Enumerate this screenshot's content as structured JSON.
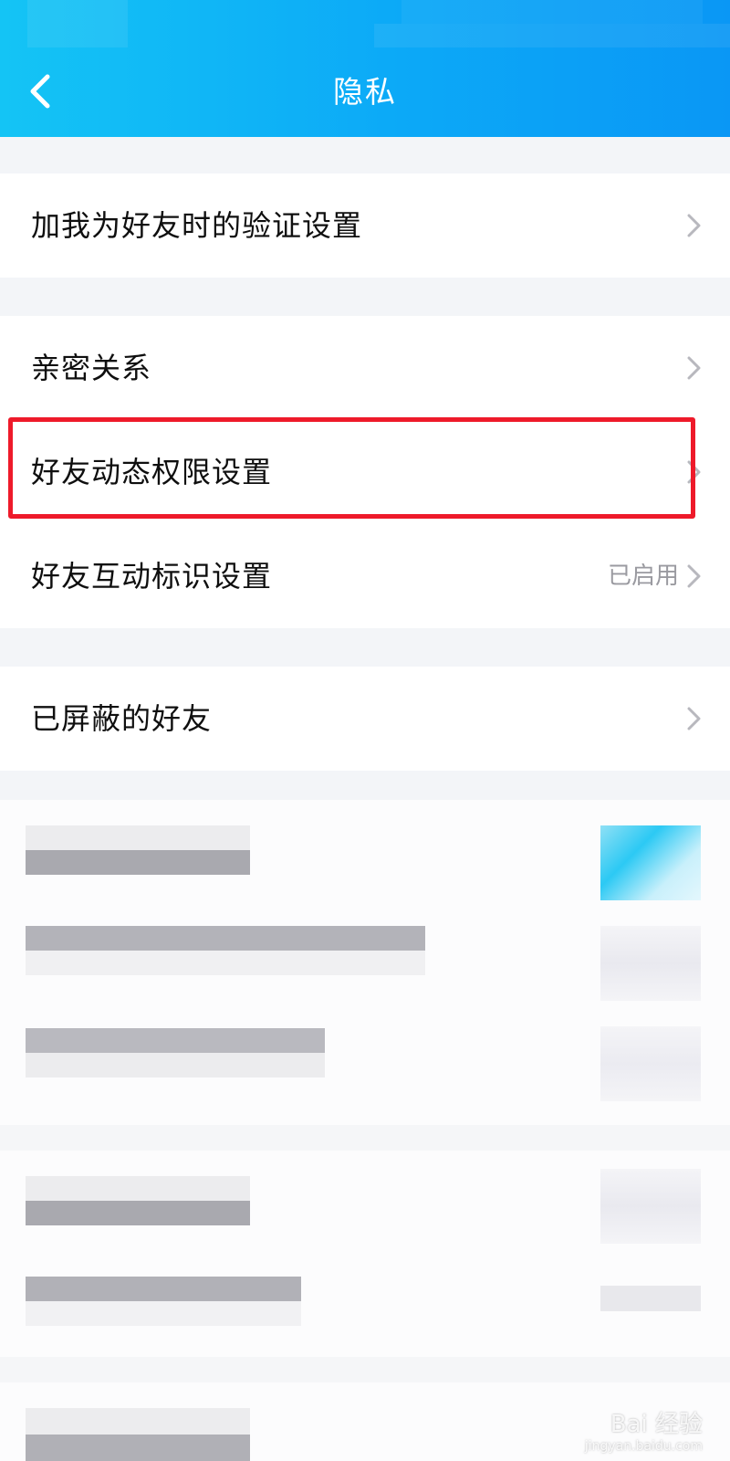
{
  "header": {
    "title": "隐私",
    "colors": {
      "gradient_start": "#14c4f5",
      "gradient_end": "#0a97f5",
      "title": "#ffffff"
    }
  },
  "items": [
    {
      "label": "加我为好友时的验证设置",
      "value": ""
    },
    {
      "label": "亲密关系",
      "value": ""
    },
    {
      "label": "好友动态权限设置",
      "value": "",
      "highlighted": true
    },
    {
      "label": "好友互动标识设置",
      "value": "已启用"
    },
    {
      "label": "已屏蔽的好友",
      "value": ""
    }
  ],
  "colors": {
    "highlight": "#ee1a2a",
    "value_text": "#9a9aa0",
    "label_text": "#0f0f0f",
    "page_bg": "#f3f5f8"
  },
  "icons": {
    "back": "chevron-left-icon",
    "row_arrow": "chevron-right-icon"
  },
  "watermark": {
    "main": "Bai 经验",
    "sub": "jingyan.baidu.com"
  }
}
